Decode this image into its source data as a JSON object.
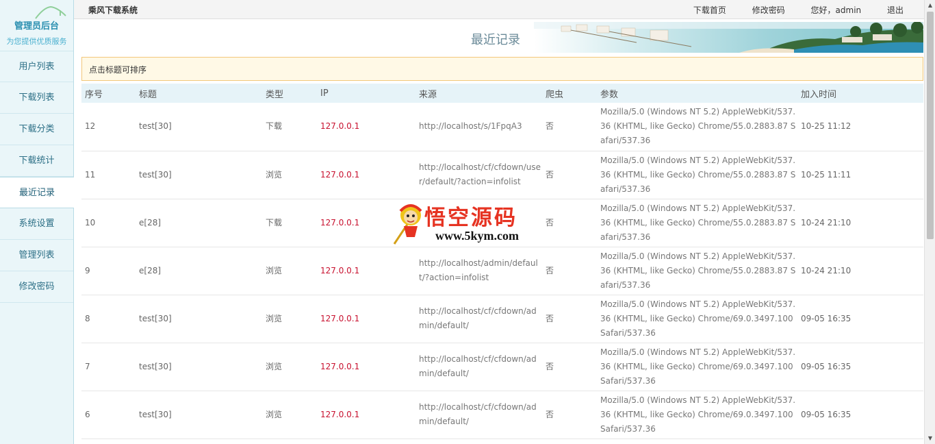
{
  "sidebar": {
    "brand_title": "管理员后台",
    "brand_sub": "为您提供优质服务",
    "items": [
      {
        "label": "用户列表"
      },
      {
        "label": "下载列表"
      },
      {
        "label": "下载分类"
      },
      {
        "label": "下载统计"
      },
      {
        "label": "最近记录",
        "active": true
      },
      {
        "label": "系统设置"
      },
      {
        "label": "管理列表"
      },
      {
        "label": "修改密码"
      }
    ]
  },
  "topbar": {
    "system_name": "乘风下载系统",
    "links": [
      "下载首页",
      "修改密码",
      "您好，admin",
      "退出"
    ]
  },
  "page": {
    "title": "最近记录",
    "notice": "点击标题可排序"
  },
  "table": {
    "headers": [
      "序号",
      "标题",
      "类型",
      "IP",
      "来源",
      "爬虫",
      "参数",
      "加入时间"
    ],
    "rows": [
      [
        "12",
        "test[30]",
        "下载",
        "127.0.0.1",
        "http://localhost/s/1FpqA3",
        "否",
        "Mozilla/5.0 (Windows NT 5.2) AppleWebKit/537.36 (KHTML, like Gecko) Chrome/55.0.2883.87 Safari/537.36",
        "10-25 11:12"
      ],
      [
        "11",
        "test[30]",
        "浏览",
        "127.0.0.1",
        "http://localhost/cf/cfdown/user/default/?action=infolist",
        "否",
        "Mozilla/5.0 (Windows NT 5.2) AppleWebKit/537.36 (KHTML, like Gecko) Chrome/55.0.2883.87 Safari/537.36",
        "10-25 11:11"
      ],
      [
        "10",
        "e[28]",
        "下载",
        "127.0.0.1",
        "",
        "否",
        "Mozilla/5.0 (Windows NT 5.2) AppleWebKit/537.36 (KHTML, like Gecko) Chrome/55.0.2883.87 Safari/537.36",
        "10-24 21:10"
      ],
      [
        "9",
        "e[28]",
        "浏览",
        "127.0.0.1",
        "http://localhost/admin/default/?action=infolist",
        "否",
        "Mozilla/5.0 (Windows NT 5.2) AppleWebKit/537.36 (KHTML, like Gecko) Chrome/55.0.2883.87 Safari/537.36",
        "10-24 21:10"
      ],
      [
        "8",
        "test[30]",
        "浏览",
        "127.0.0.1",
        "http://localhost/cf/cfdown/admin/default/",
        "否",
        "Mozilla/5.0 (Windows NT 5.2) AppleWebKit/537.36 (KHTML, like Gecko) Chrome/69.0.3497.100 Safari/537.36",
        "09-05 16:35"
      ],
      [
        "7",
        "test[30]",
        "浏览",
        "127.0.0.1",
        "http://localhost/cf/cfdown/admin/default/",
        "否",
        "Mozilla/5.0 (Windows NT 5.2) AppleWebKit/537.36 (KHTML, like Gecko) Chrome/69.0.3497.100 Safari/537.36",
        "09-05 16:35"
      ],
      [
        "6",
        "test[30]",
        "浏览",
        "127.0.0.1",
        "http://localhost/cf/cfdown/admin/default/",
        "否",
        "Mozilla/5.0 (Windows NT 5.2) AppleWebKit/537.36 (KHTML, like Gecko) Chrome/69.0.3497.100 Safari/537.36",
        "09-05 16:35"
      ]
    ]
  },
  "watermark": {
    "cn": "悟空源码",
    "url": "www.5kym.com"
  },
  "colors": {
    "accent": "#2a8fb0",
    "ip": "#c8102e",
    "notice_bg": "#fff9e6",
    "header_bg": "#e6f3f8"
  },
  "icons": [
    "house-roof-logo-icon",
    "scroll-up-arrow-icon",
    "scroll-down-arrow-icon",
    "monkey-mascot-icon",
    "beach-resort-banner-image"
  ]
}
